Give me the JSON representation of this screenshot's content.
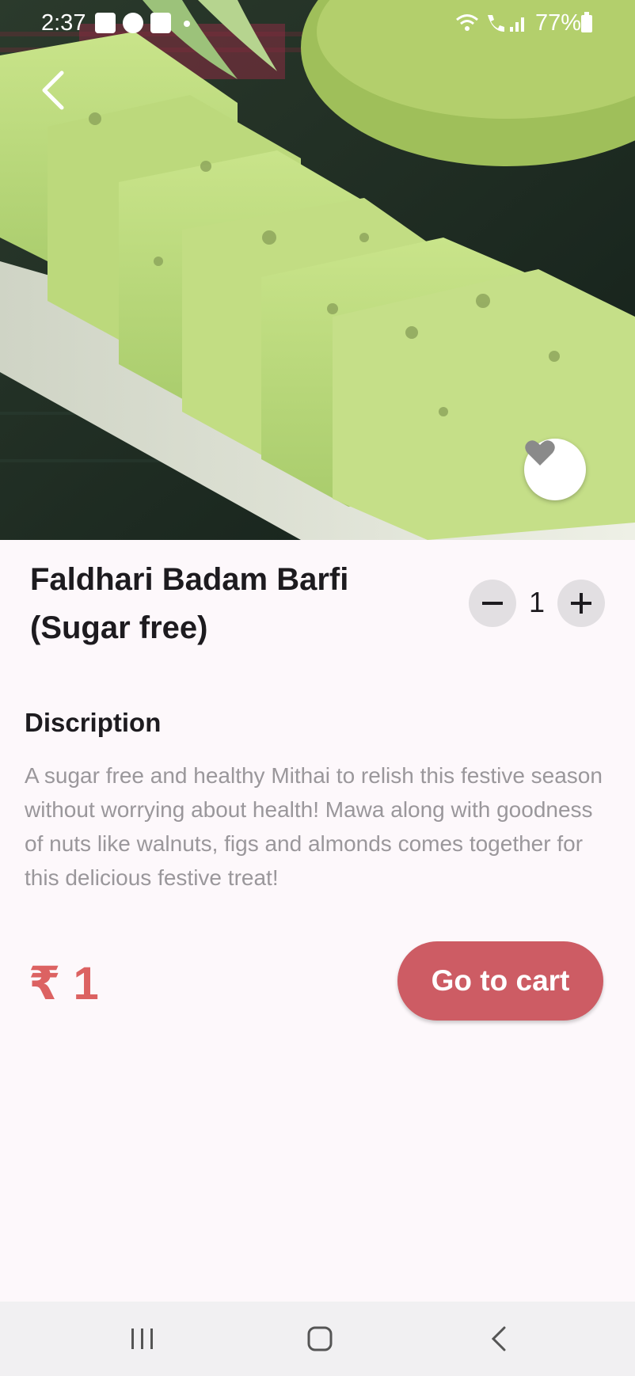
{
  "status_bar": {
    "time": "2:37",
    "battery": "77%"
  },
  "product": {
    "title_line1": "Faldhari Badam Barfi",
    "title_line2": "(Sugar free)",
    "quantity": "1",
    "description_heading": "Discription",
    "description": "A sugar free and healthy Mithai to relish this festive season without worrying about health! Mawa along with goodness of nuts like walnuts, figs and almonds comes together for this delicious festive treat!",
    "price": "₹ 1"
  },
  "actions": {
    "cart_label": "Go to cart"
  },
  "icons": {
    "back": "chevron-left-icon",
    "favorite": "heart-icon",
    "minus": "minus-icon",
    "plus": "plus-icon"
  },
  "colors": {
    "accent": "#cd5c64",
    "price": "#dc6262",
    "background": "#fdf8fb"
  }
}
